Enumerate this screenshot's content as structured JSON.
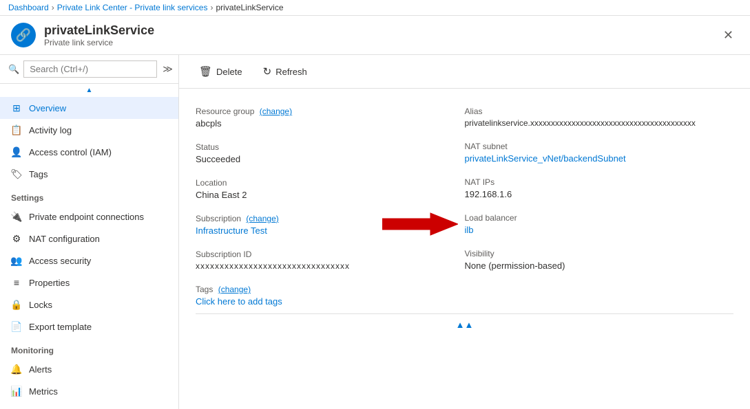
{
  "breadcrumb": {
    "items": [
      {
        "label": "Dashboard",
        "link": true
      },
      {
        "label": "Private Link Center - Private link services",
        "link": true
      },
      {
        "label": "privateLinkService",
        "link": false
      }
    ]
  },
  "header": {
    "icon": "🔗",
    "title": "privateLinkService",
    "subtitle": "Private link service",
    "close_label": "✕"
  },
  "toolbar": {
    "delete_label": "Delete",
    "refresh_label": "Refresh"
  },
  "sidebar": {
    "search_placeholder": "Search (Ctrl+/)",
    "nav_items": [
      {
        "id": "overview",
        "icon": "⊞",
        "label": "Overview",
        "active": true,
        "section": null
      },
      {
        "id": "activity-log",
        "icon": "📋",
        "label": "Activity log",
        "active": false,
        "section": null
      },
      {
        "id": "access-control",
        "icon": "👤",
        "label": "Access control (IAM)",
        "active": false,
        "section": null
      },
      {
        "id": "tags",
        "icon": "🏷",
        "label": "Tags",
        "active": false,
        "section": null
      },
      {
        "id": "settings-section",
        "section_label": "Settings",
        "is_section": true
      },
      {
        "id": "private-endpoint",
        "icon": "🔌",
        "label": "Private endpoint connections",
        "active": false,
        "section": null
      },
      {
        "id": "nat-config",
        "icon": "⚙",
        "label": "NAT configuration",
        "active": false,
        "section": null
      },
      {
        "id": "access-security",
        "icon": "👥",
        "label": "Access security",
        "active": false,
        "section": null
      },
      {
        "id": "properties",
        "icon": "≡",
        "label": "Properties",
        "active": false,
        "section": null
      },
      {
        "id": "locks",
        "icon": "🔒",
        "label": "Locks",
        "active": false,
        "section": null
      },
      {
        "id": "export-template",
        "icon": "📄",
        "label": "Export template",
        "active": false,
        "section": null
      },
      {
        "id": "monitoring-section",
        "section_label": "Monitoring",
        "is_section": true
      },
      {
        "id": "alerts",
        "icon": "🔔",
        "label": "Alerts",
        "active": false,
        "section": null
      },
      {
        "id": "metrics",
        "icon": "📊",
        "label": "Metrics",
        "active": false,
        "section": null
      }
    ]
  },
  "main": {
    "fields": {
      "resource_group_label": "Resource group",
      "resource_group_change": "(change)",
      "resource_group_value": "abcpls",
      "status_label": "Status",
      "status_value": "Succeeded",
      "location_label": "Location",
      "location_value": "China East 2",
      "subscription_label": "Subscription",
      "subscription_change": "(change)",
      "subscription_value": "Infrastructure Test",
      "subscription_id_label": "Subscription ID",
      "subscription_id_value": "xxxxxxxxxxxxxxxxxxxxxxxxxxxxxxxx",
      "tags_label": "Tags",
      "tags_change": "(change)",
      "tags_add": "Click here to add tags",
      "alias_label": "Alias",
      "alias_value": "privatelinkservice.xxxxxxxxxxxxxxxxxxxxxxxxxxxxxxxxxxxxxxxx",
      "nat_subnet_label": "NAT subnet",
      "nat_subnet_value": "privateLinkService_vNet/backendSubnet",
      "nat_ips_label": "NAT IPs",
      "nat_ips_value": "192.168.1.6",
      "load_balancer_label": "Load balancer",
      "load_balancer_value": "ilb",
      "visibility_label": "Visibility",
      "visibility_value": "None (permission-based)"
    }
  }
}
